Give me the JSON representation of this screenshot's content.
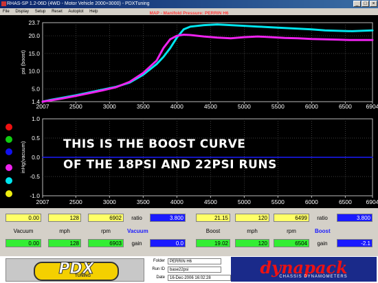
{
  "window": {
    "title": "RHAS-SP 1.2-06D (4WD - Motor Vehicle 2000+3000) - PDXTuning",
    "minimize": "_",
    "maximize": "□",
    "close": "×"
  },
  "menu": [
    "File",
    "Display",
    "Setup",
    "Reset",
    "Autoplot",
    "Help"
  ],
  "map_title": "MAP - Manifold Pressure: PERRIN H6",
  "overlay_text": {
    "line1": "THIS IS THE BOOST CURVE",
    "line2": "OF THE 18PSI AND 22PSI RUNS"
  },
  "chart_data": [
    {
      "type": "line",
      "ylabel": "psi (boost)",
      "xlim": [
        2007,
        6904
      ],
      "ylim": [
        1.4,
        23.7
      ],
      "x_ticks": [
        "2007",
        "2500",
        "3000",
        "3500",
        "4000",
        "4500",
        "5000",
        "5500",
        "6000",
        "6500",
        "6904"
      ],
      "y_ticks": [
        "1.4",
        "5.0",
        "10.0",
        "15.0",
        "20.0",
        "23.7"
      ],
      "grid": true,
      "series": [
        {
          "color": "#00e5ee",
          "x": [
            2007,
            2100,
            2300,
            2500,
            2700,
            2900,
            3100,
            3300,
            3500,
            3700,
            3800,
            3900,
            4000,
            4100,
            4200,
            4400,
            4600,
            4800,
            5000,
            5200,
            5400,
            5600,
            5800,
            6000,
            6200,
            6400,
            6600,
            6904
          ],
          "y": [
            1.4,
            1.8,
            2.5,
            3.2,
            4.0,
            4.8,
            5.6,
            6.8,
            9.0,
            12.0,
            14.0,
            16.5,
            19.5,
            21.8,
            22.6,
            23.0,
            23.2,
            23.0,
            22.8,
            22.6,
            22.4,
            22.2,
            22.0,
            21.8,
            21.5,
            21.4,
            21.3,
            21.5
          ]
        },
        {
          "color": "#ee22ee",
          "x": [
            2007,
            2100,
            2300,
            2500,
            2700,
            2900,
            3100,
            3300,
            3500,
            3700,
            3800,
            3900,
            4000,
            4100,
            4200,
            4400,
            4600,
            4800,
            5000,
            5200,
            5400,
            5600,
            5800,
            6000,
            6200,
            6400,
            6600,
            6904
          ],
          "y": [
            1.4,
            1.7,
            2.3,
            3.0,
            3.8,
            4.6,
            5.5,
            7.0,
            9.5,
            13.0,
            16.5,
            19.0,
            20.0,
            20.3,
            20.2,
            19.8,
            19.5,
            19.3,
            19.6,
            19.8,
            19.6,
            19.4,
            19.3,
            19.1,
            19.0,
            18.9,
            18.8,
            18.8
          ]
        }
      ]
    },
    {
      "type": "line",
      "ylabel": "inHg(vacuum)",
      "xlim": [
        2007,
        6904
      ],
      "ylim": [
        -1.0,
        1.0
      ],
      "x_ticks": [
        "2007",
        "2500",
        "3000",
        "3500",
        "4000",
        "4500",
        "5000",
        "5500",
        "6000",
        "6500",
        "6904"
      ],
      "y_ticks": [
        "1.0",
        "0.5",
        "0.0",
        "-0.5",
        "-1.0"
      ],
      "grid": true,
      "series": [
        {
          "color": "#1a1aff",
          "x": [
            2007,
            6904
          ],
          "y": [
            0.0,
            0.0
          ]
        }
      ]
    }
  ],
  "legend_dots": [
    "#ee1111",
    "#11cc11",
    "#1111ee",
    "#ee22ee",
    "#00e5ee",
    "#eeee11"
  ],
  "readouts": {
    "row1": {
      "v1": "0.00",
      "v2": "128",
      "v3": "6902",
      "ratio_label": "ratio",
      "ratio": "3.800",
      "v4": "21.15",
      "v5": "120",
      "v6": "6499",
      "ratio2_label": "ratio",
      "ratio2": "3.800"
    },
    "labels": {
      "vacuum": "Vacuum",
      "mph": "mph",
      "rpm": "rpm",
      "vacuum_blue": "Vacuum",
      "boost": "Boost",
      "mph2": "mph",
      "rpm2": "rpm",
      "boost_blue": "Boost"
    },
    "row2": {
      "v1": "0.00",
      "v2": "128",
      "v3": "6903",
      "gain_label": "gain",
      "gain": "0.0",
      "v4": "19.02",
      "v5": "120",
      "v6": "6504",
      "gain2_label": "gain",
      "gain2": "-2.1"
    }
  },
  "footer": {
    "logo_left": "PDX",
    "logo_left_sub": "TUNING",
    "folder_label": "Folder",
    "folder": "PERRIN H6",
    "runid_label": "Run ID",
    "runid": "base22psi",
    "date_label": "Date",
    "date": "16-Dec-2006  16:02:28",
    "logo_right": "dynapack",
    "logo_right_sub": "CHASSIS DYNAMOMETERS"
  }
}
